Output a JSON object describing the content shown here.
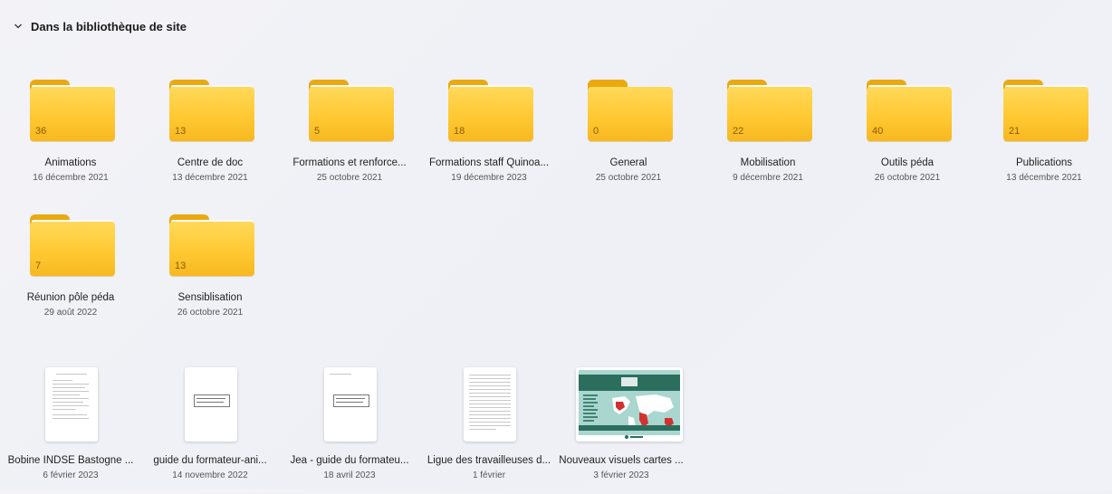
{
  "section": {
    "title": "Dans la bibliothèque de site"
  },
  "folders": [
    {
      "count": "36",
      "name": "Animations",
      "date": "16 décembre 2021"
    },
    {
      "count": "13",
      "name": "Centre de doc",
      "date": "13 décembre 2021"
    },
    {
      "count": "5",
      "name": "Formations et renforce...",
      "date": "25 octobre 2021"
    },
    {
      "count": "18",
      "name": "Formations staff Quinoa...",
      "date": "19 décembre 2023"
    },
    {
      "count": "0",
      "name": "General",
      "date": "25 octobre 2021"
    },
    {
      "count": "22",
      "name": "Mobilisation",
      "date": "9 décembre 2021"
    },
    {
      "count": "40",
      "name": "Outils péda",
      "date": "26 octobre 2021"
    },
    {
      "count": "21",
      "name": "Publications",
      "date": "13 décembre 2021"
    },
    {
      "count": "7",
      "name": "Réunion pôle péda",
      "date": "29 août 2022"
    },
    {
      "count": "13",
      "name": "Sensiblisation",
      "date": "26 octobre 2021"
    }
  ],
  "files": [
    {
      "name": "Bobine INDSE Bastogne ...",
      "date": "6 février 2023"
    },
    {
      "name": "guide du formateur-ani...",
      "date": "14 novembre 2022"
    },
    {
      "name": "Jea - guide du formateu...",
      "date": "18 avril 2023"
    },
    {
      "name": "Ligue des travailleuses d...",
      "date": "1 février"
    },
    {
      "name": "Nouveaux visuels cartes ...",
      "date": "3 février 2023"
    }
  ],
  "colors": {
    "folder_body": "#ffc933",
    "folder_tab": "#e9a90f",
    "map_banner": "#2b6e5e",
    "map_bg": "#a9d6cf"
  },
  "icons": {
    "section_toggle": "chevron-down-icon"
  }
}
